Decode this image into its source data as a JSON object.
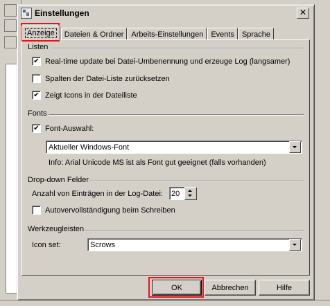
{
  "window": {
    "title": "Einstellungen",
    "close_glyph": "✕"
  },
  "tabs": [
    {
      "label": "Anzeige",
      "active": true
    },
    {
      "label": "Dateien & Ordner"
    },
    {
      "label": "Arbeits-Einstellungen"
    },
    {
      "label": "Events"
    },
    {
      "label": "Sprache"
    }
  ],
  "sections": {
    "listen": {
      "title": "Listen",
      "options": [
        {
          "label": "Real-time update bei Datei-Umbenennung und erzeuge Log (langsamer)",
          "checked": true
        },
        {
          "label": "Spalten der Datei-Liste zurücksetzen",
          "checked": false
        },
        {
          "label": "Zeigt Icons in der Dateiliste",
          "checked": true
        }
      ]
    },
    "fonts": {
      "title": "Fonts",
      "font_choice_label": "Font-Auswahl:",
      "font_choice_checked": true,
      "font_select_value": "Aktueller Windows-Font",
      "info": "Info: Arial Unicode MS ist als Font gut geeignet (falls vorhanden)"
    },
    "dropdown": {
      "title": "Drop-down Felder",
      "entries_label": "Anzahl von Einträgen in der Log-Datei:",
      "entries_value": "20",
      "autocomplete_label": "Autovervollständigung beim Schreiben",
      "autocomplete_checked": false
    },
    "toolbars": {
      "title": "Werkzeugleisten",
      "iconset_label": "Icon set:",
      "iconset_value": "Scrows"
    }
  },
  "buttons": {
    "ok": "OK",
    "cancel": "Abbrechen",
    "help": "Hilfe"
  },
  "colors": {
    "highlight": "#e8131b",
    "face": "#d4d0c8"
  },
  "icons": {
    "check": "✔"
  }
}
